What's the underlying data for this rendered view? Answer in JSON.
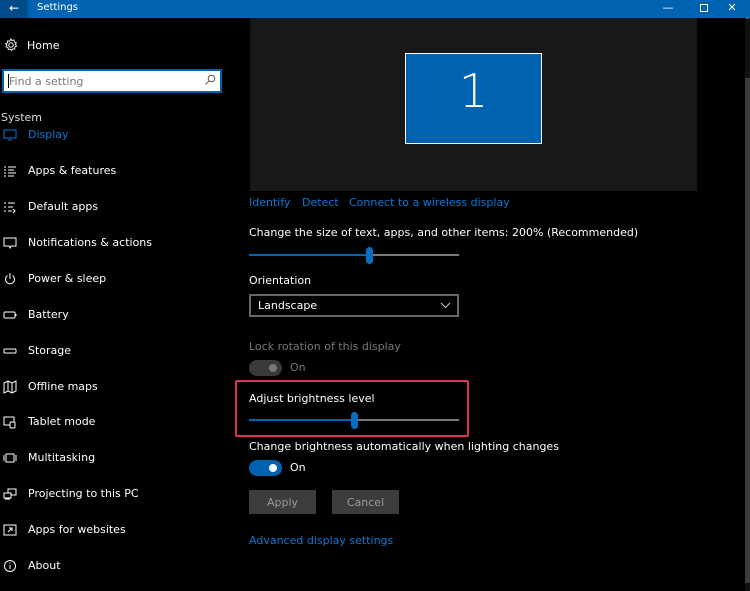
{
  "window": {
    "title": "Settings",
    "back_icon": "back-arrow-icon",
    "minimize_glyph": "—",
    "close_glyph": "✕"
  },
  "sidebar": {
    "home_label": "Home",
    "search_placeholder": "Find a setting",
    "section_title": "System",
    "items": [
      {
        "label": "Display",
        "icon": "monitor-icon",
        "active": true
      },
      {
        "label": "Apps & features",
        "icon": "list-icon",
        "active": false
      },
      {
        "label": "Default apps",
        "icon": "default-apps-icon",
        "active": false
      },
      {
        "label": "Notifications & actions",
        "icon": "notification-icon",
        "active": false
      },
      {
        "label": "Power & sleep",
        "icon": "power-icon",
        "active": false
      },
      {
        "label": "Battery",
        "icon": "battery-icon",
        "active": false
      },
      {
        "label": "Storage",
        "icon": "storage-icon",
        "active": false
      },
      {
        "label": "Offline maps",
        "icon": "map-icon",
        "active": false
      },
      {
        "label": "Tablet mode",
        "icon": "tablet-mode-icon",
        "active": false
      },
      {
        "label": "Multitasking",
        "icon": "multitasking-icon",
        "active": false
      },
      {
        "label": "Projecting to this PC",
        "icon": "projecting-icon",
        "active": false
      },
      {
        "label": "Apps for websites",
        "icon": "apps-websites-icon",
        "active": false
      },
      {
        "label": "About",
        "icon": "info-icon",
        "active": false
      }
    ]
  },
  "main": {
    "monitor_number": "1",
    "links": {
      "identify": "Identify",
      "detect": "Detect",
      "connect": "Connect to a wireless display"
    },
    "scale": {
      "label": "Change the size of text, apps, and other items: 200% (Recommended)",
      "value_fraction": 0.57
    },
    "orientation": {
      "label": "Orientation",
      "selected": "Landscape"
    },
    "lock_rotation": {
      "label": "Lock rotation of this display",
      "state_label": "On",
      "enabled": false
    },
    "brightness": {
      "label": "Adjust brightness level",
      "value_fraction": 0.5
    },
    "auto_brightness": {
      "label": "Change brightness automatically when lighting changes",
      "state_label": "On",
      "on": true
    },
    "buttons": {
      "apply": "Apply",
      "cancel": "Cancel"
    },
    "advanced_link": "Advanced display settings"
  },
  "colors": {
    "accent": "#0063b1",
    "link": "#0a78d7",
    "highlight_box": "#e0305a",
    "background": "#000000"
  }
}
